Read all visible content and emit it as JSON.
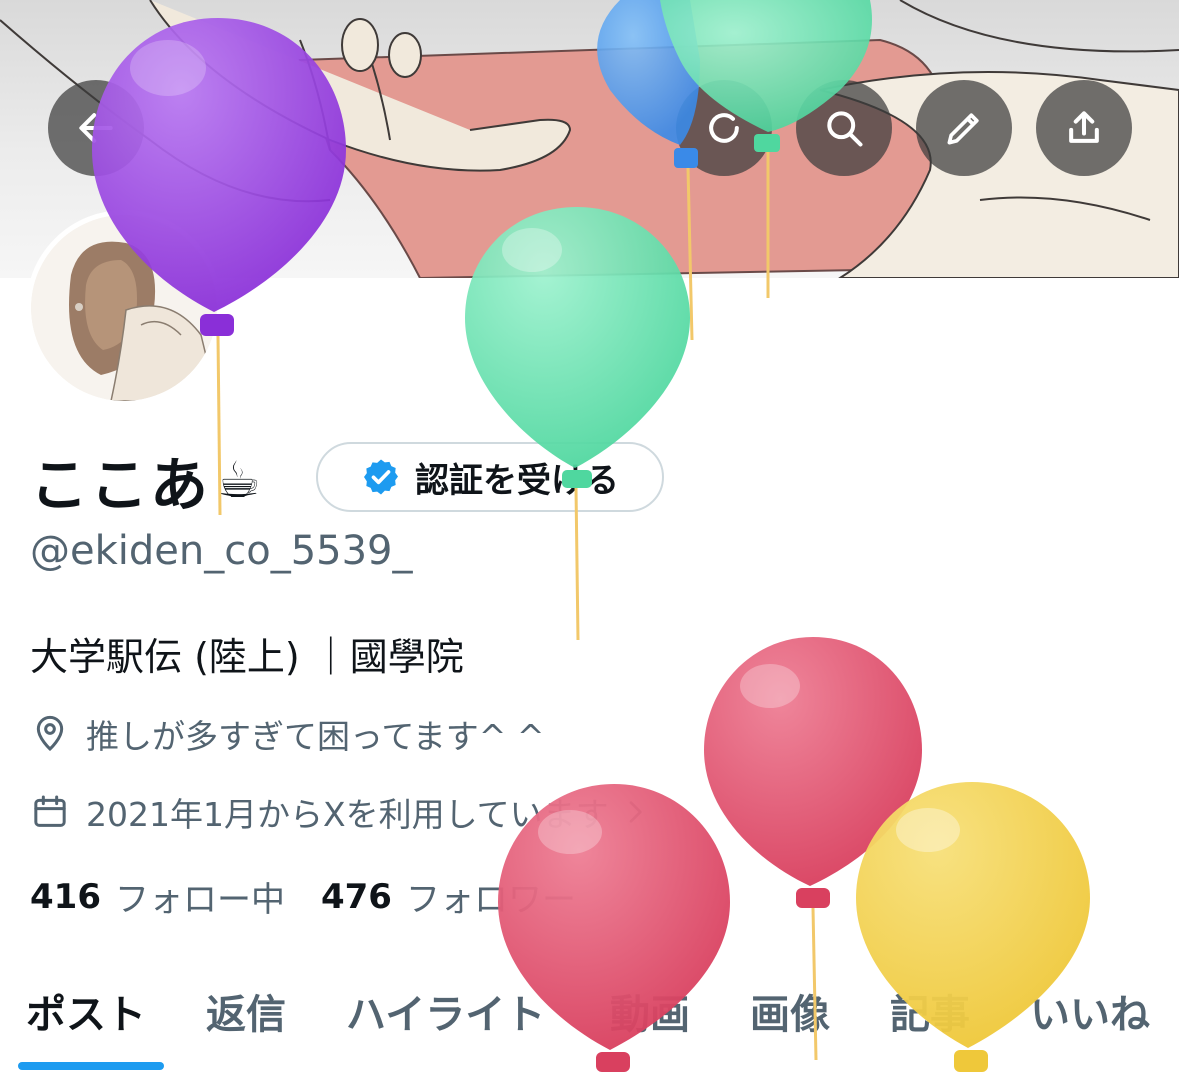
{
  "header": {
    "back_icon": "arrow-left-icon",
    "refresh_icon": "refresh-icon",
    "search_icon": "search-icon",
    "edit_icon": "pencil-icon",
    "share_icon": "share-icon"
  },
  "profile": {
    "display_name": "ここあ",
    "name_emoji": "☕",
    "verify_button_label": "認証を受ける",
    "handle": "@ekiden_co_5539_",
    "bio": "大学駅伝 (陸上) ｜國學院",
    "location": "推しが多すぎて困ってます^ ^",
    "joined": "2021年1月からXを利用しています",
    "following_count": "416",
    "following_label": "フォロー中",
    "followers_count": "476",
    "followers_label": "フォロワー"
  },
  "tabs": [
    "ポスト",
    "返信",
    "ハイライト",
    "動画",
    "画像",
    "記事",
    "いいね"
  ],
  "active_tab": "ポスト",
  "colors": {
    "accent": "#1d9bf0",
    "verified": "#1d9bf0",
    "secondary_text": "#536471",
    "balloon_purple": "#9b45e0",
    "balloon_green": "#6be3b0",
    "balloon_blue": "#4a9bf0",
    "balloon_red": "#e05070",
    "balloon_yellow": "#f2d04a"
  }
}
